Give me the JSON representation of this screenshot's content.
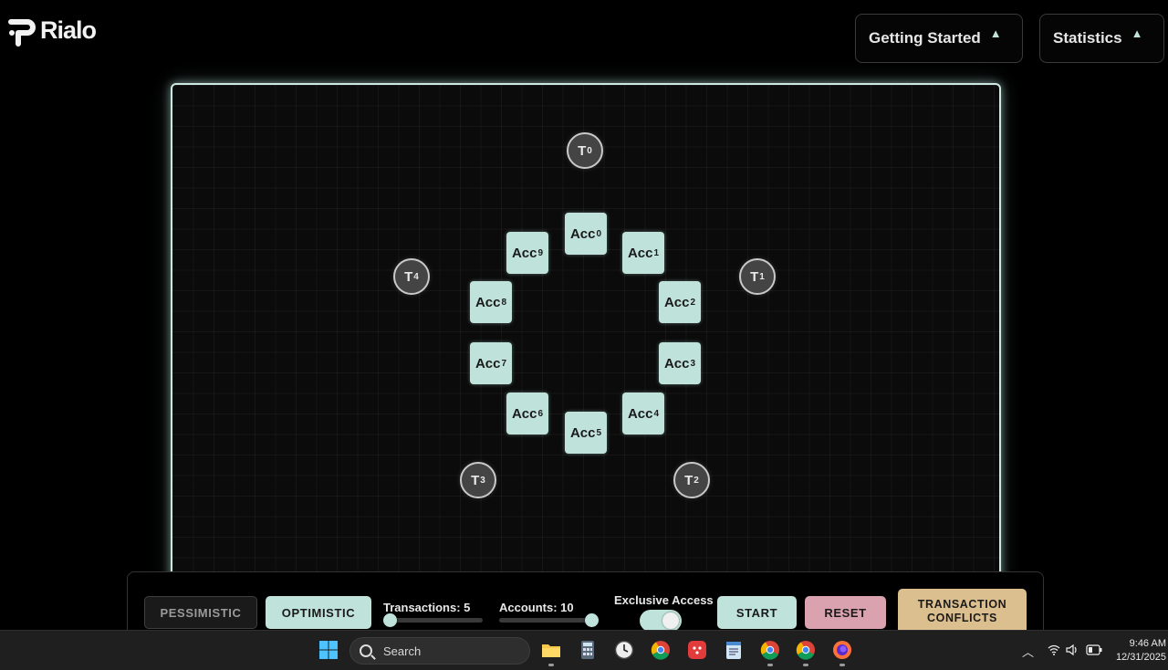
{
  "app": {
    "brand": "Rialo"
  },
  "header": {
    "getting_started": "Getting Started",
    "statistics": "Statistics",
    "expand_glyph": "▲"
  },
  "transactions": [
    {
      "base": "T",
      "sub": "0"
    },
    {
      "base": "T",
      "sub": "1"
    },
    {
      "base": "T",
      "sub": "2"
    },
    {
      "base": "T",
      "sub": "3"
    },
    {
      "base": "T",
      "sub": "4"
    }
  ],
  "accounts": [
    {
      "base": "Acc",
      "sub": "0"
    },
    {
      "base": "Acc",
      "sub": "1"
    },
    {
      "base": "Acc",
      "sub": "2"
    },
    {
      "base": "Acc",
      "sub": "3"
    },
    {
      "base": "Acc",
      "sub": "4"
    },
    {
      "base": "Acc",
      "sub": "5"
    },
    {
      "base": "Acc",
      "sub": "6"
    },
    {
      "base": "Acc",
      "sub": "7"
    },
    {
      "base": "Acc",
      "sub": "8"
    },
    {
      "base": "Acc",
      "sub": "9"
    }
  ],
  "controls": {
    "pessimistic": "PESSIMISTIC",
    "optimistic": "OPTIMISTIC",
    "selected_mode": "OPTIMISTIC",
    "transactions_label": "Transactions: 5",
    "transactions_level": 0.0,
    "accounts_label": "Accounts: 10",
    "accounts_level": 1.0,
    "exclusive_access_label": "Exclusive Access",
    "exclusive_access_on": true,
    "start": "START",
    "reset": "RESET",
    "conflicts_line1": "TRANSACTION",
    "conflicts_line2": "CONFLICTS"
  },
  "colors": {
    "accent": "#bfe3da",
    "reset": "#d9a2ae",
    "conflicts": "#dcbf8f",
    "transaction_node": "#444444"
  },
  "taskbar": {
    "search_placeholder": "Search",
    "time": "9:46 AM",
    "date": "12/31/2025",
    "icons": [
      "windows-start-icon",
      "file-explorer-icon",
      "calculator-icon",
      "clock-icon",
      "chrome-icon",
      "red-app-icon",
      "notepad-icon",
      "chrome-active-icon",
      "chrome-icon-2",
      "firefox-icon"
    ],
    "tray_icons": [
      "chevron-up-icon",
      "wifi-icon",
      "volume-icon",
      "battery-icon"
    ]
  }
}
